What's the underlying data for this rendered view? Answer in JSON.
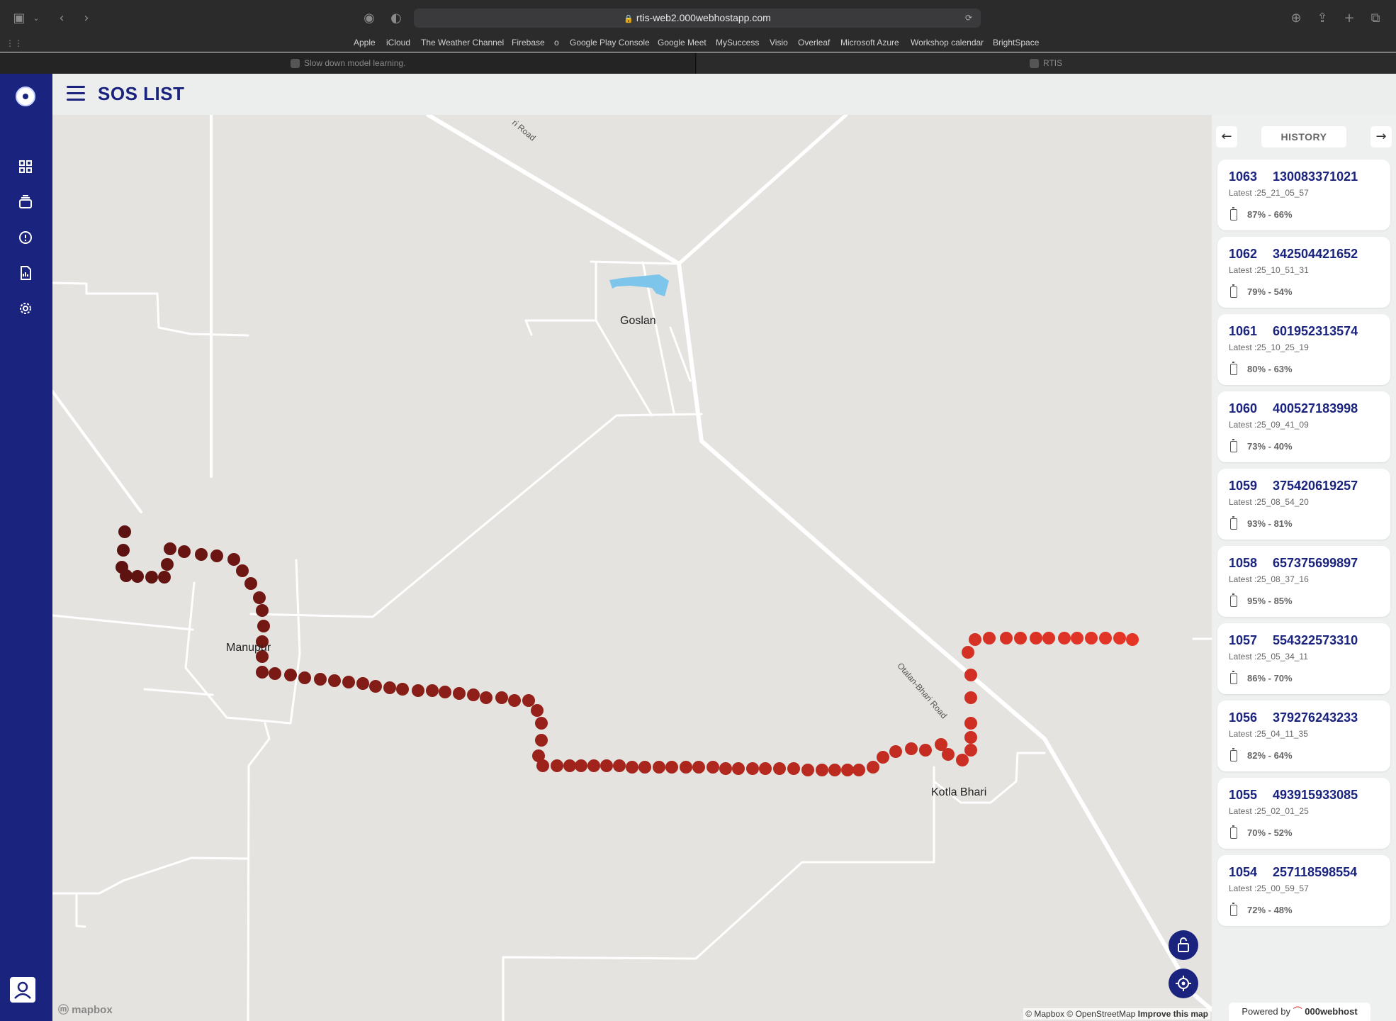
{
  "browser": {
    "url": "rtis-web2.000webhostapp.com",
    "bookmarks": [
      "Apple",
      "iCloud",
      "The Weather Channel",
      "Firebase",
      "o",
      "Google Play Console",
      "Google Meet",
      "MySuccess",
      "Visio",
      "Overleaf",
      "Microsoft Azure",
      "Workshop calendar",
      "BrightSpace"
    ],
    "tabs": [
      {
        "title": "Slow down model learning.",
        "active": false
      },
      {
        "title": "RTIS",
        "active": true
      }
    ]
  },
  "sidebar": {
    "items": [
      {
        "icon": "dashboard-icon"
      },
      {
        "icon": "layers-icon"
      },
      {
        "icon": "alert-icon"
      },
      {
        "icon": "report-icon"
      },
      {
        "icon": "settings-icon"
      }
    ]
  },
  "header": {
    "title": "SOS LIST"
  },
  "map": {
    "places": [
      "Goslan",
      "Manupur",
      "Kotla Bhari"
    ],
    "roads": [
      "Otalan-Bhari Road",
      "ri Road"
    ],
    "logo": "mapbox",
    "attribution": "© Mapbox © OpenStreetMap",
    "improve_link": "Improve this map",
    "track_colors": {
      "start": "#5b1210",
      "end": "#e53527"
    }
  },
  "history": {
    "title": "HISTORY",
    "entries": [
      {
        "id": "1063",
        "number": "130083371021",
        "latest": "Latest :25_21_05_57",
        "battery": "87% - 66%"
      },
      {
        "id": "1062",
        "number": "342504421652",
        "latest": "Latest :25_10_51_31",
        "battery": "79% - 54%"
      },
      {
        "id": "1061",
        "number": "601952313574",
        "latest": "Latest :25_10_25_19",
        "battery": "80% - 63%"
      },
      {
        "id": "1060",
        "number": "400527183998",
        "latest": "Latest :25_09_41_09",
        "battery": "73% - 40%"
      },
      {
        "id": "1059",
        "number": "375420619257",
        "latest": "Latest :25_08_54_20",
        "battery": "93% - 81%"
      },
      {
        "id": "1058",
        "number": "657375699897",
        "latest": "Latest :25_08_37_16",
        "battery": "95% - 85%"
      },
      {
        "id": "1057",
        "number": "554322573310",
        "latest": "Latest :25_05_34_11",
        "battery": "86% - 70%"
      },
      {
        "id": "1056",
        "number": "379276243233",
        "latest": "Latest :25_04_11_35",
        "battery": "82% - 64%"
      },
      {
        "id": "1055",
        "number": "493915933085",
        "latest": "Latest :25_02_01_25",
        "battery": "70% - 52%"
      },
      {
        "id": "1054",
        "number": "257118598554",
        "latest": "Latest :25_00_59_57",
        "battery": "72% - 48%"
      }
    ]
  },
  "footer": {
    "powered_by": "Powered by",
    "host": "000webhost"
  }
}
